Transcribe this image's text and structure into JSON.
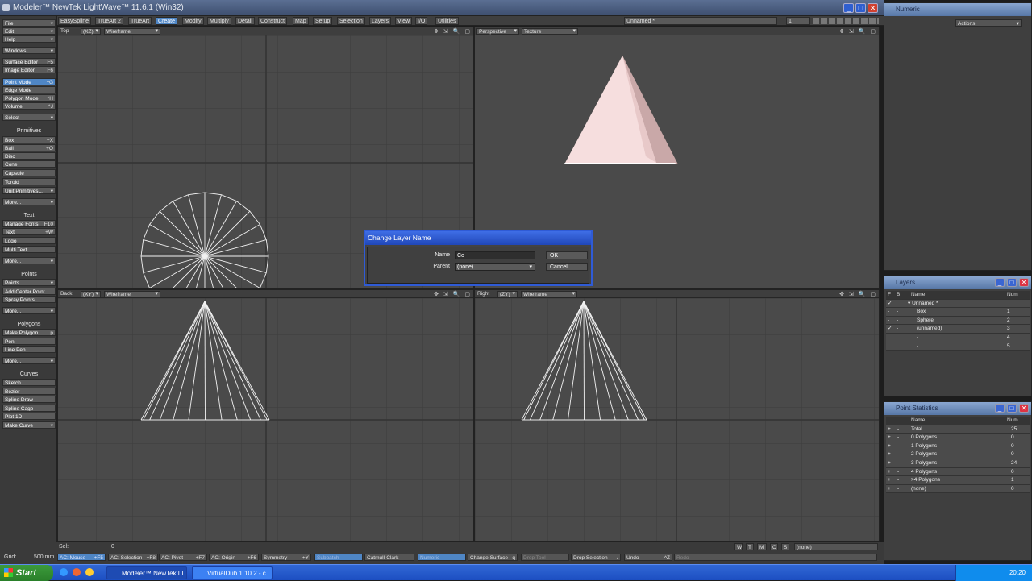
{
  "window": {
    "title": "Modeler™ NewTek LightWave™ 11.6.1 (Win32)",
    "min": "_",
    "max": "□",
    "close": "✕"
  },
  "menubar": {
    "tabs": [
      "EasySpline",
      "TrueArt 2",
      "TrueArt",
      "Create",
      "Modify",
      "Multiply",
      "Detail",
      "Construct",
      "Map",
      "Setup",
      "Selection",
      "Layers",
      "View",
      "I/O",
      "Utilities"
    ],
    "active": "Create",
    "object_name": "Unnamed *",
    "layer_num": "1"
  },
  "left": {
    "file": "File",
    "edit": "Edit",
    "help": "Help",
    "windows": "Windows",
    "surface_editor": {
      "label": "Surface Editor",
      "sc": "F5"
    },
    "image_editor": {
      "label": "Image Editor",
      "sc": "F6"
    },
    "point_mode": {
      "label": "Point Mode",
      "sc": "^G"
    },
    "edge_mode": {
      "label": "Edge Mode"
    },
    "polygon_mode": {
      "label": "Polygon Mode",
      "sc": "^H"
    },
    "volume": {
      "label": "Volume",
      "sc": "^J"
    },
    "select": "Select",
    "primitives": "Primitives",
    "box": {
      "label": "Box",
      "sc": "+X"
    },
    "ball": {
      "label": "Ball",
      "sc": "+O"
    },
    "disc": "Disc",
    "cone": "Cone",
    "capsule": "Capsule",
    "toroid": "Toroid",
    "unit_primitives": "Unit Primitives...",
    "more1": "More...",
    "text_hdr": "Text",
    "manage_fonts": {
      "label": "Manage Fonts",
      "sc": "F10"
    },
    "text": {
      "label": "Text",
      "sc": "+W"
    },
    "logo": "Logo",
    "multi_text": "Multi Text",
    "more2": "More...",
    "points_hdr": "Points",
    "points": "Points",
    "add_center_point": "Add Center Point",
    "spray_points": "Spray Points",
    "more3": "More...",
    "polygons_hdr": "Polygons",
    "make_polygon": {
      "label": "Make Polygon",
      "sc": "p"
    },
    "pen": "Pen",
    "line_pen": "Line Pen",
    "more4": "More...",
    "curves_hdr": "Curves",
    "sketch": "Sketch",
    "bezier": "Bezier",
    "spline_draw": "Spline Draw",
    "spline_cage": "Spline Cage",
    "plot_1d": "Plot 1D",
    "make_curve": "Make Curve"
  },
  "viewports": {
    "tl": {
      "view": "Top",
      "axis": "(XZ)",
      "mode": "Wireframe"
    },
    "tr": {
      "view": "Perspective",
      "mode": "Texture"
    },
    "bl": {
      "view": "Back",
      "axis": "(XY)",
      "mode": "Wireframe"
    },
    "br": {
      "view": "Right",
      "axis": "(ZY)",
      "mode": "Wireframe"
    },
    "icons": "✥ ⇲ 🔍 ▢"
  },
  "dialog": {
    "title": "Change Layer Name",
    "name_label": "Name",
    "name_value": "Co",
    "parent_label": "Parent",
    "parent_value": "(none)",
    "ok": "OK",
    "cancel": "Cancel"
  },
  "bottom": {
    "sel_label": "Sel:",
    "sel_value": "0",
    "grid_label": "Grid:",
    "grid_value": "500 mm",
    "wtmcs": [
      "W",
      "T",
      "M",
      "C",
      "S"
    ],
    "none": "(none)",
    "buttons": [
      "AC: Mouse",
      "AC: Selection",
      "AC: Pivot",
      "AC: Origin",
      "Symmetry",
      "Subpatch",
      "Catmull-Clark",
      "Numeric",
      "Change Surface",
      "Drop Tool",
      "Drop Selection",
      "Undo",
      "Redo"
    ],
    "shortcuts": [
      "+F5",
      "+F8",
      "+F7",
      "+F6",
      "+Y",
      "q",
      "/",
      "^Z"
    ]
  },
  "numeric": {
    "title": "Numeric",
    "actions": "Actions"
  },
  "layers": {
    "title": "Layers",
    "headers": {
      "f": "F",
      "b": "B",
      "name": "Name",
      "num": "Num"
    },
    "rows": [
      {
        "f": "✓",
        "b": "",
        "name": "▾ Unnamed *",
        "num": ""
      },
      {
        "f": "-",
        "b": "-",
        "name": "Box",
        "num": "1"
      },
      {
        "f": "-",
        "b": "-",
        "name": "Sphere",
        "num": "2"
      },
      {
        "f": "✓",
        "b": "-",
        "name": "(unnamed)",
        "num": "3"
      },
      {
        "f": "",
        "b": "",
        "name": "-",
        "num": "4"
      },
      {
        "f": "",
        "b": "",
        "name": "-",
        "num": "5"
      }
    ]
  },
  "pointstats": {
    "title": "Point Statistics",
    "headers": {
      "name": "Name",
      "num": "Num"
    },
    "rows": [
      {
        "name": "Total",
        "num": "25"
      },
      {
        "name": "0 Polygons",
        "num": "0"
      },
      {
        "name": "1 Polygons",
        "num": "0"
      },
      {
        "name": "2 Polygons",
        "num": "0"
      },
      {
        "name": "3 Polygons",
        "num": "24"
      },
      {
        "name": "4 Polygons",
        "num": "0"
      },
      {
        "name": ">4 Polygons",
        "num": "1"
      },
      {
        "name": "(none)",
        "num": "0"
      }
    ]
  },
  "taskbar": {
    "start": "Start",
    "tasks": [
      "Modeler™ NewTek LI...",
      "VirtualDub 1.10.2 - c..."
    ],
    "time": "20:20"
  },
  "colors": {
    "accent": "#4f86c5",
    "dialog_title": "#2047b8",
    "viewport": "#4a4a4a"
  }
}
